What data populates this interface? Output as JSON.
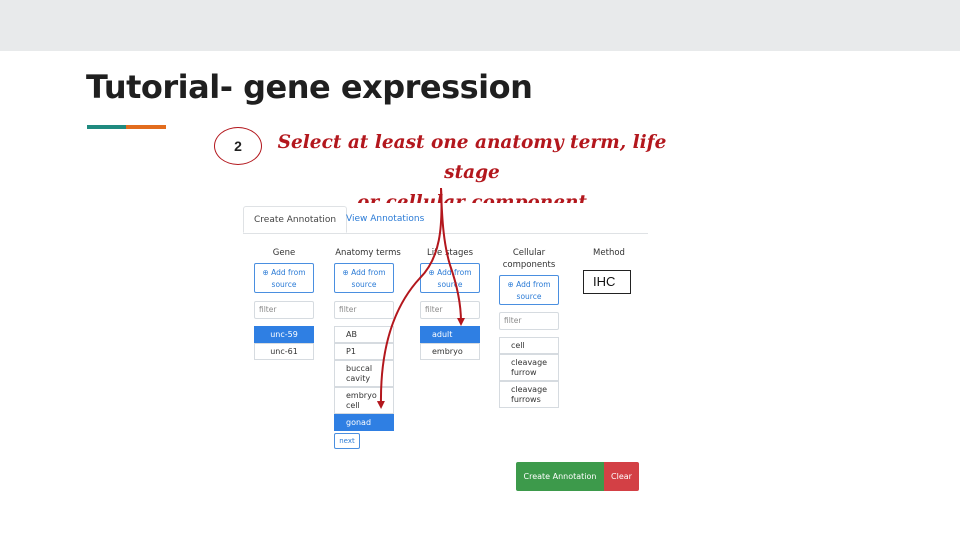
{
  "slide": {
    "title": "Tutorial- gene expression",
    "step_number": "2",
    "instruction_line1": "Select at least one anatomy term, life stage",
    "instruction_line2": "or cellular component",
    "accent_colors": [
      "#1f8a7f",
      "#e26c1d"
    ],
    "annotation_color": "#b3171d"
  },
  "app": {
    "tabs": [
      {
        "label": "Create Annotation",
        "active": true
      },
      {
        "label": "View Annotations",
        "active": false
      }
    ],
    "columns": {
      "gene": {
        "header": "Gene",
        "add_label_1": "⊕ Add from",
        "add_label_2": "source",
        "filter_placeholder": "filter",
        "items": [
          {
            "label": "unc-59",
            "selected": true
          },
          {
            "label": "unc-61",
            "selected": false
          }
        ]
      },
      "anatomy": {
        "header": "Anatomy terms",
        "add_label_1": "⊕ Add from",
        "add_label_2": "source",
        "filter_placeholder": "filter",
        "items": [
          {
            "label": "AB",
            "selected": false
          },
          {
            "label": "P1",
            "selected": false
          },
          {
            "label_1": "buccal",
            "label_2": "cavity",
            "selected": false
          },
          {
            "label_1": "embryo",
            "label_2": "cell",
            "selected": false
          },
          {
            "label": "gonad",
            "selected": true
          }
        ],
        "next_label": "next"
      },
      "life_stages": {
        "header": "Life stages",
        "add_label_1": "⊕ Add from",
        "add_label_2": "source",
        "filter_placeholder": "filter",
        "items": [
          {
            "label": "adult",
            "selected": true
          },
          {
            "label": "embryo",
            "selected": false
          }
        ]
      },
      "cellular": {
        "header_1": "Cellular",
        "header_2": "components",
        "add_label_1": "⊕ Add from",
        "add_label_2": "source",
        "filter_placeholder": "filter",
        "items": [
          {
            "label": "cell",
            "selected": false
          },
          {
            "label_1": "cleavage",
            "label_2": "furrow",
            "selected": false
          },
          {
            "label_1": "cleavage",
            "label_2": "furrows",
            "selected": false
          }
        ]
      },
      "method": {
        "header": "Method",
        "value": "IHC"
      }
    },
    "create_label": "Create Annotation",
    "clear_label": "Clear",
    "colors": {
      "create": "#3d9a4b",
      "clear": "#d34045",
      "selected": "#2f7fe3",
      "link": "#2b7bd6"
    }
  }
}
